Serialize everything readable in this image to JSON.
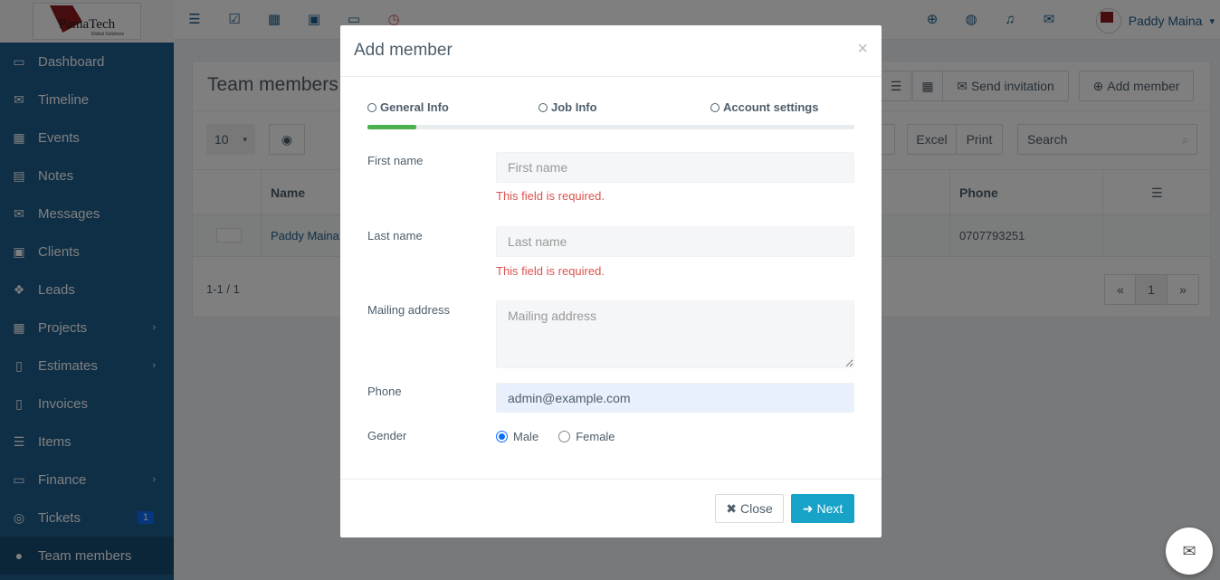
{
  "brand": {
    "name": "PamaTech",
    "tagline": "Global Solutions"
  },
  "sidebar": {
    "items": [
      {
        "label": "Dashboard",
        "icon": "monitor-icon",
        "glyph": "▭"
      },
      {
        "label": "Timeline",
        "icon": "comments-icon",
        "glyph": "✉"
      },
      {
        "label": "Events",
        "icon": "calendar-icon",
        "glyph": "▦"
      },
      {
        "label": "Notes",
        "icon": "book-icon",
        "glyph": "▤"
      },
      {
        "label": "Messages",
        "icon": "envelope-icon",
        "glyph": "✉"
      },
      {
        "label": "Clients",
        "icon": "briefcase-icon",
        "glyph": "▣"
      },
      {
        "label": "Leads",
        "icon": "cubes-icon",
        "glyph": "❖"
      },
      {
        "label": "Projects",
        "icon": "th-large-icon",
        "glyph": "▦",
        "chevron": "›"
      },
      {
        "label": "Estimates",
        "icon": "file-icon",
        "glyph": "▯",
        "chevron": "›"
      },
      {
        "label": "Invoices",
        "icon": "file-text-icon",
        "glyph": "▯"
      },
      {
        "label": "Items",
        "icon": "list-icon",
        "glyph": "☰"
      },
      {
        "label": "Finance",
        "icon": "money-icon",
        "glyph": "▭",
        "chevron": "›"
      },
      {
        "label": "Tickets",
        "icon": "life-ring-icon",
        "glyph": "◎",
        "badge": "1"
      },
      {
        "label": "Team members",
        "icon": "user-icon",
        "glyph": "●",
        "active": true
      }
    ]
  },
  "topbar": {
    "left_icons": [
      "list-icon",
      "checkbox-icon",
      "grid-icon",
      "briefcase-icon",
      "monitor-icon",
      "clock-icon"
    ],
    "left_glyphs": [
      "☰",
      "☑",
      "▦",
      "▣",
      "▭",
      "◷"
    ],
    "right_icons": [
      "plus-circle-icon",
      "globe-icon",
      "bell-icon",
      "envelope-icon"
    ],
    "right_glyphs": [
      "⊕",
      "◍",
      "♫",
      "✉"
    ],
    "user_name": "Paddy Maina",
    "user_caret": "▾"
  },
  "page": {
    "title": "Team members",
    "send_invitation": "Send invitation",
    "add_member": "Add member",
    "page_size": "10",
    "excel": "Excel",
    "print": "Print",
    "search_placeholder": "Search",
    "columns": {
      "name": "Name",
      "phone": "Phone"
    },
    "row": {
      "name": "Paddy Maina",
      "phone": "0707793251"
    },
    "pagination_info": "1-1 / 1",
    "page_number": "1",
    "prev": "«",
    "next": "»"
  },
  "modal": {
    "title": "Add member",
    "close_x": "×",
    "steps": [
      "General Info",
      "Job Info",
      "Account settings"
    ],
    "progress_fraction": 0.1,
    "fields": {
      "first_name": {
        "label": "First name",
        "placeholder": "First name",
        "value": "",
        "error": "This field is required."
      },
      "last_name": {
        "label": "Last name",
        "placeholder": "Last name",
        "value": "",
        "error": "This field is required."
      },
      "mailing_address": {
        "label": "Mailing address",
        "placeholder": "Mailing address",
        "value": ""
      },
      "phone": {
        "label": "Phone",
        "value": "admin@example.com"
      },
      "gender": {
        "label": "Gender",
        "options": [
          "Male",
          "Female"
        ],
        "selected": "Male"
      }
    },
    "close_button": "Close",
    "next_button": "Next"
  },
  "colors": {
    "sidebar": "#1f5f8e",
    "accent": "#17a2c8",
    "error": "#d9534f",
    "progress": "#4caf50"
  }
}
